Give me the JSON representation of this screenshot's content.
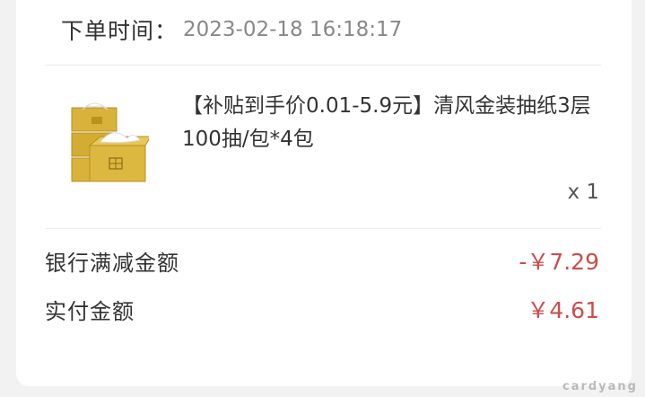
{
  "order": {
    "time_label": "下单时间：",
    "time_value": "2023-02-18 16:18:17"
  },
  "product": {
    "title": "【补贴到手价0.01-5.9元】清风金装抽纸3层100抽/包*4包",
    "quantity": "x 1",
    "image_icon": "tissue-box-pack-icon"
  },
  "summary": {
    "bank_discount_label": "银行满减金额",
    "bank_discount_value": "-￥7.29",
    "paid_label": "实付金额",
    "paid_value": "￥4.61"
  },
  "watermark": "cardyang",
  "colors": {
    "price_red": "#cf4b4b",
    "gold": "#d8b23a"
  }
}
